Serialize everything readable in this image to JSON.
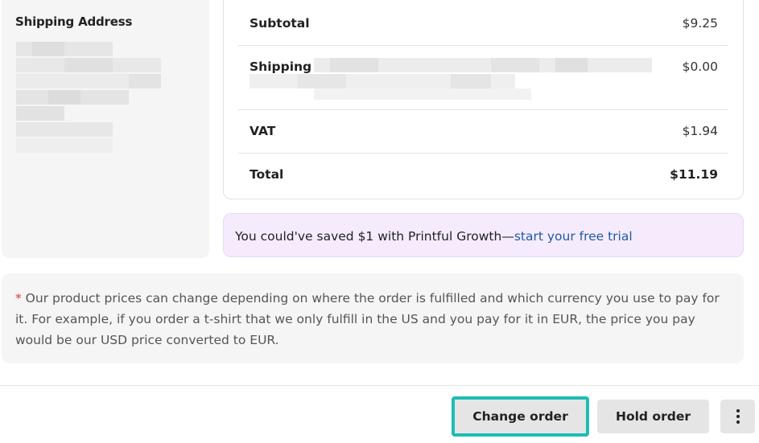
{
  "shipping": {
    "title": "Shipping Address"
  },
  "summary": {
    "rows": [
      {
        "label": "Subtotal",
        "value": "$9.25"
      },
      {
        "label": "Shipping",
        "value": "$0.00"
      },
      {
        "label": "VAT",
        "value": "$1.94"
      },
      {
        "label": "Total",
        "value": "$11.19"
      }
    ]
  },
  "promo": {
    "text": "You could've saved $1 with Printful Growth—",
    "link": "start your free trial"
  },
  "note": {
    "asterisk": "*",
    "text": " Our product prices can change depending on where the order is fulfilled and which currency you use to pay for it. For example, if you order a t-shirt that we only fulfill in the US and you pay for it in EUR, the price you pay would be our USD price converted to EUR."
  },
  "actions": {
    "change_order": "Change order",
    "hold_order": "Hold order",
    "more_icon": "vertical-dots-icon"
  }
}
